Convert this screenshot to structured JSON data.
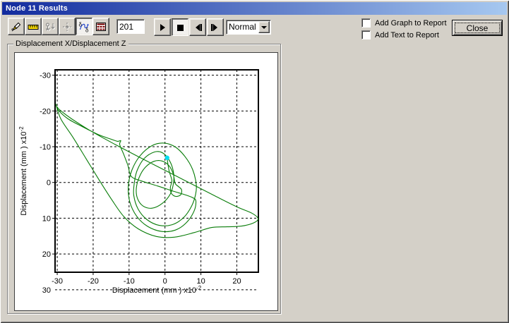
{
  "window": {
    "title": "Node 11 Results"
  },
  "toolbar": {
    "frame_value": "201",
    "speed_value": "Normal",
    "delta_glyph": "δ",
    "buttons": [
      {
        "name": "animate",
        "icon": "rocket-icon",
        "state": "normal"
      },
      {
        "name": "measure",
        "icon": "ruler-icon",
        "state": "normal"
      },
      {
        "name": "probe",
        "icon": "probe-icon",
        "state": "disabled"
      },
      {
        "name": "crosshair",
        "icon": "crosshair-icon",
        "state": "disabled"
      },
      {
        "name": "graph-view",
        "icon": "delta-curve-icon",
        "state": "pressed"
      },
      {
        "name": "table-view",
        "icon": "table-grid-icon",
        "state": "normal"
      }
    ],
    "playback": [
      {
        "name": "play",
        "state": "normal"
      },
      {
        "name": "stop",
        "state": "pressed"
      },
      {
        "name": "step-back",
        "state": "normal"
      },
      {
        "name": "step-forward",
        "state": "normal"
      }
    ]
  },
  "report": {
    "add_graph_label": "Add Graph to Report",
    "add_text_label": "Add Text to Report"
  },
  "close_label": "Close",
  "chart_data": {
    "type": "line",
    "subtype": "orbit-trajectory",
    "title": "Displacement X/Displacement Z",
    "xlabel": "Displacement (mm ) x10",
    "xlabel_sup": "-2",
    "ylabel": "Displacement (mm ) x10",
    "ylabel_sup": "-2",
    "x_ticks": [
      -30,
      -20,
      -10,
      0,
      10,
      20
    ],
    "y_ticks": [
      -30,
      -20,
      -10,
      0,
      10,
      20,
      30
    ],
    "xlim": [
      -30.6,
      26.0
    ],
    "ylim": [
      -31.5,
      25.1
    ],
    "y_axis_inverted": true,
    "grid": "dashed",
    "grid_color": "#000000",
    "line_color": "#087c08",
    "marker": {
      "x": 0.6,
      "y": -6.9,
      "color": "#00e0f0"
    },
    "trajectory": [
      [
        -30.4,
        -22.0
      ],
      [
        -29.0,
        -17.8
      ],
      [
        -25.6,
        -12.6
      ],
      [
        -22.0,
        -6.7
      ],
      [
        -18.4,
        -0.8
      ],
      [
        -14.9,
        4.7
      ],
      [
        -11.4,
        9.6
      ],
      [
        -7.4,
        13.0
      ],
      [
        -2.4,
        15.1
      ],
      [
        2.6,
        15.3
      ],
      [
        8.2,
        14.0
      ],
      [
        13.0,
        12.6
      ],
      [
        17.3,
        12.4
      ],
      [
        21.3,
        12.2
      ],
      [
        24.7,
        11.3
      ],
      [
        25.9,
        10.1
      ],
      [
        24.2,
        8.6
      ],
      [
        20.0,
        6.8
      ],
      [
        14.0,
        3.8
      ],
      [
        7.0,
        0.2
      ],
      [
        0.0,
        -3.4
      ],
      [
        -7.0,
        -7.0
      ],
      [
        -14.0,
        -10.7
      ],
      [
        -20.5,
        -14.3
      ],
      [
        -26.0,
        -17.8
      ],
      [
        -29.3,
        -20.3
      ],
      [
        -30.1,
        -21.2
      ],
      [
        -29.6,
        -20.1
      ],
      [
        -27.0,
        -17.8
      ],
      [
        -23.0,
        -15.6
      ],
      [
        -18.6,
        -13.4
      ],
      [
        -15.0,
        -12.1
      ],
      [
        -13.2,
        -11.5
      ],
      [
        -12.3,
        -11.7
      ],
      [
        -12.6,
        -10.6
      ],
      [
        -11.5,
        -7.9
      ],
      [
        -10.3,
        -4.7
      ],
      [
        -9.4,
        -1.7
      ],
      [
        -6.5,
        -0.4
      ],
      [
        -2.0,
        1.0
      ],
      [
        2.5,
        2.5
      ],
      [
        5.8,
        3.5
      ],
      [
        7.8,
        4.3
      ],
      [
        8.6,
        5.2
      ],
      [
        8.1,
        8.0
      ],
      [
        6.0,
        11.2
      ],
      [
        2.9,
        13.3
      ],
      [
        -0.9,
        13.7
      ],
      [
        -4.8,
        12.3
      ],
      [
        -7.9,
        9.4
      ],
      [
        -9.8,
        5.4
      ],
      [
        -10.2,
        0.9
      ],
      [
        -9.2,
        -3.5
      ],
      [
        -6.9,
        -7.5
      ],
      [
        -3.6,
        -10.3
      ],
      [
        -0.2,
        -11.0
      ],
      [
        2.9,
        -9.9
      ],
      [
        5.6,
        -7.2
      ],
      [
        7.7,
        -3.6
      ],
      [
        8.7,
        0.5
      ],
      [
        8.5,
        3.4
      ],
      [
        7.4,
        6.6
      ],
      [
        5.2,
        9.8
      ],
      [
        2.0,
        11.8
      ],
      [
        -1.6,
        12.0
      ],
      [
        -5.0,
        10.4
      ],
      [
        -7.5,
        7.4
      ],
      [
        -8.7,
        3.5
      ],
      [
        -8.5,
        -0.2
      ],
      [
        -7.7,
        -3.5
      ],
      [
        -5.8,
        -6.7
      ],
      [
        -3.0,
        -8.5
      ],
      [
        -0.7,
        -8.3
      ],
      [
        1.2,
        -6.2
      ],
      [
        2.3,
        -3.2
      ],
      [
        2.4,
        -0.1
      ],
      [
        1.5,
        3.2
      ],
      [
        -0.8,
        5.9
      ],
      [
        -3.6,
        7.2
      ],
      [
        -6.1,
        6.6
      ],
      [
        -7.6,
        4.6
      ],
      [
        -8.0,
        1.9
      ],
      [
        -7.2,
        -1.4
      ],
      [
        -5.5,
        -4.2
      ],
      [
        -3.1,
        -5.9
      ],
      [
        -0.8,
        -6.0
      ],
      [
        1.1,
        -4.7
      ],
      [
        2.3,
        -2.4
      ],
      [
        2.8,
        0.2
      ],
      [
        3.7,
        1.1
      ],
      [
        4.6,
        2.0
      ],
      [
        4.4,
        3.4
      ],
      [
        3.0,
        3.9
      ],
      [
        1.8,
        3.1
      ],
      [
        1.5,
        1.5
      ],
      [
        1.9,
        -0.6
      ],
      [
        1.2,
        -3.0
      ],
      [
        0.8,
        -5.2
      ],
      [
        0.6,
        -6.9
      ]
    ]
  }
}
